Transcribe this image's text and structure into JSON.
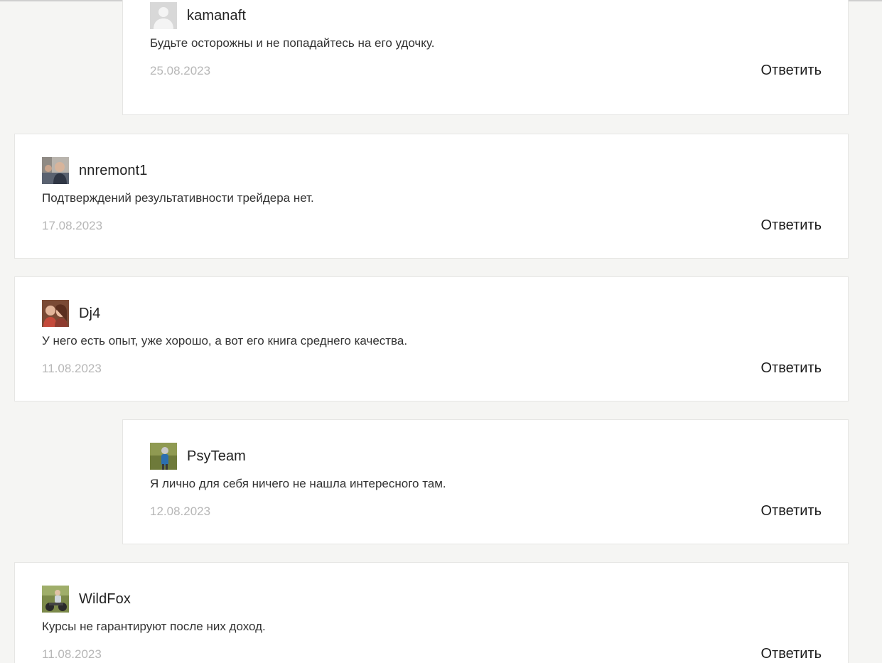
{
  "comments": [
    {
      "author": "kamanaft",
      "text": "Будьте осторожны и не попадайтесь на его удочку.",
      "date": "25.08.2023",
      "reply_label": "Ответить",
      "avatar": "default-user-avatar"
    },
    {
      "author": "nnremont1",
      "text": "Подтверждений результативности трейдера нет.",
      "date": "17.08.2023",
      "reply_label": "Ответить",
      "avatar": "user-photo-avatar"
    },
    {
      "author": "Dj4",
      "text": "У него есть опыт, уже хорошо, а вот его книга среднего качества.",
      "date": "11.08.2023",
      "reply_label": "Ответить",
      "avatar": "user-photo-avatar"
    },
    {
      "author": "PsyTeam",
      "text": "Я лично для себя ничего не нашла интересного там.",
      "date": "12.08.2023",
      "reply_label": "Ответить",
      "avatar": "user-photo-avatar"
    },
    {
      "author": "WildFox",
      "text": "Курсы не гарантируют после них доход.",
      "date": "11.08.2023",
      "reply_label": "Ответить",
      "avatar": "user-photo-avatar"
    }
  ]
}
